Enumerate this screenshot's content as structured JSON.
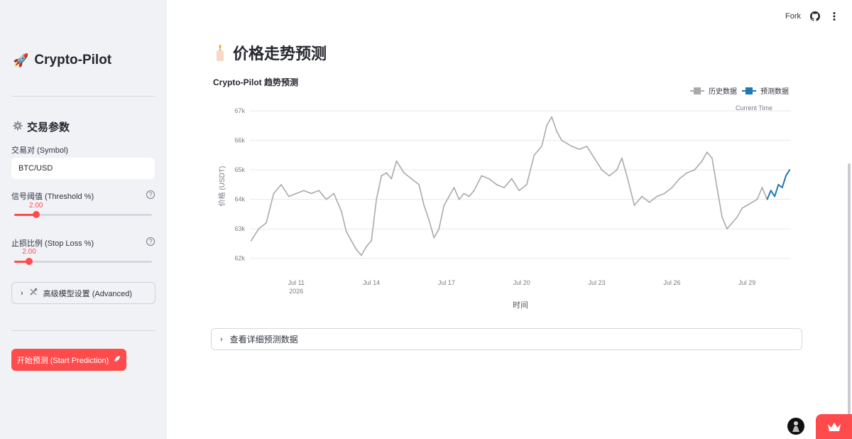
{
  "header": {
    "fork_label": "Fork"
  },
  "sidebar": {
    "app_title": "Crypto-Pilot",
    "section_title": "交易参数",
    "symbol": {
      "label": "交易对 (Symbol)",
      "value": "BTC/USD"
    },
    "threshold": {
      "label": "信号阈值 (Threshold %)",
      "value_text": "2.00",
      "fraction": 0.16
    },
    "stoploss": {
      "label": "止损比例 (Stop Loss %)",
      "value_text": "2.00",
      "fraction": 0.11
    },
    "help_glyph": "?",
    "advanced_label": "高级模型设置 (Advanced)",
    "start_button_label": "开始预测 (Start Prediction)",
    "accent_color": "#ff4b4b"
  },
  "main": {
    "page_title": "价格走势预测",
    "details_expander_label": "查看详细预测数据"
  },
  "chart_data": {
    "type": "line",
    "title": "Crypto-Pilot 趋势预测",
    "xlabel": "时间",
    "ylabel": "价格 (USDT)",
    "ylim": [
      61800,
      67100
    ],
    "yticks": [
      62000,
      63000,
      64000,
      65000,
      66000,
      67000
    ],
    "ytick_labels": [
      "62k",
      "63k",
      "64k",
      "65k",
      "66k",
      "67k"
    ],
    "xticks": [
      11,
      14,
      17,
      20,
      23,
      26,
      29
    ],
    "xtick_labels": [
      "Jul 11",
      "Jul 14",
      "Jul 17",
      "Jul 20",
      "Jul 23",
      "Jul 26",
      "Jul 29"
    ],
    "xtick_sublabel": "2026",
    "xlim": [
      9.15,
      30.75
    ],
    "annotation": "Current Time",
    "grid": true,
    "legend_position": "top-right",
    "series": [
      {
        "name": "历史数据",
        "color": "#aaaaaa",
        "x": [
          9.2,
          9.5,
          9.8,
          10.1,
          10.4,
          10.7,
          11.0,
          11.3,
          11.6,
          11.9,
          12.2,
          12.5,
          12.8,
          13.0,
          13.2,
          13.4,
          13.6,
          13.8,
          14.0,
          14.2,
          14.4,
          14.6,
          14.8,
          15.0,
          15.3,
          15.6,
          15.9,
          16.1,
          16.3,
          16.5,
          16.7,
          16.9,
          17.1,
          17.3,
          17.5,
          17.7,
          17.9,
          18.1,
          18.4,
          18.7,
          19.0,
          19.3,
          19.6,
          19.9,
          20.2,
          20.5,
          20.8,
          21.0,
          21.2,
          21.4,
          21.6,
          21.8,
          22.0,
          22.3,
          22.6,
          22.9,
          23.2,
          23.5,
          23.8,
          24.0,
          24.2,
          24.5,
          24.8,
          25.1,
          25.4,
          25.7,
          26.0,
          26.3,
          26.6,
          26.9,
          27.2,
          27.4,
          27.6,
          27.8,
          28.0,
          28.2,
          28.4,
          28.6,
          28.8,
          29.0,
          29.2,
          29.4,
          29.6,
          29.8
        ],
        "y": [
          62600,
          63000,
          63200,
          64200,
          64500,
          64100,
          64200,
          64300,
          64200,
          64300,
          64000,
          64200,
          63600,
          62900,
          62600,
          62300,
          62100,
          62400,
          62600,
          64000,
          64800,
          64900,
          64700,
          65300,
          64900,
          64700,
          64500,
          63800,
          63300,
          62700,
          63000,
          63800,
          64100,
          64400,
          64000,
          64200,
          64100,
          64300,
          64800,
          64700,
          64500,
          64400,
          64700,
          64300,
          64500,
          65500,
          65800,
          66500,
          66800,
          66300,
          66000,
          65900,
          65800,
          65700,
          65800,
          65400,
          65000,
          64800,
          65000,
          65400,
          64800,
          63800,
          64100,
          63900,
          64100,
          64200,
          64400,
          64700,
          64900,
          65000,
          65300,
          65600,
          65400,
          64400,
          63400,
          63000,
          63200,
          63400,
          63700,
          63800,
          63900,
          64000,
          64400,
          64000
        ]
      },
      {
        "name": "预测数据",
        "color": "#1f77b4",
        "x": [
          29.8,
          29.95,
          30.1,
          30.25,
          30.4,
          30.55,
          30.7
        ],
        "y": [
          64000,
          64300,
          64100,
          64500,
          64400,
          64800,
          65000
        ]
      }
    ]
  }
}
